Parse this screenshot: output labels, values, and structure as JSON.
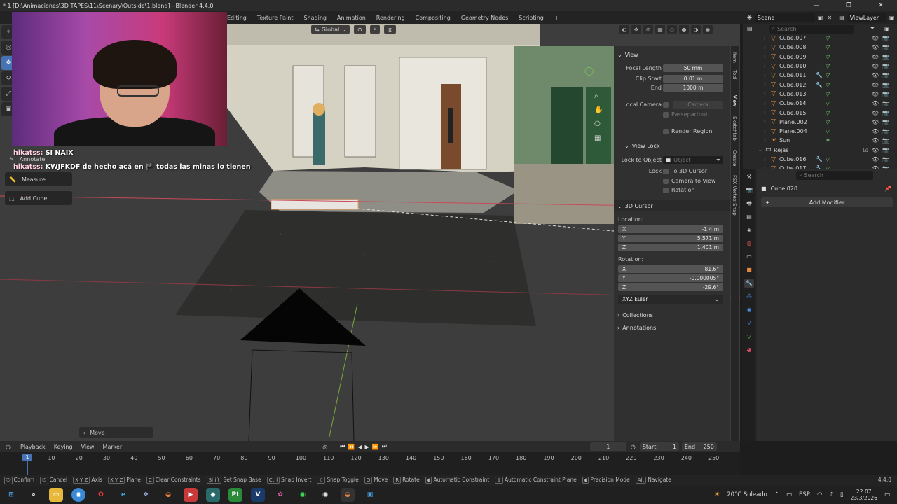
{
  "window": {
    "title": "* 1 [D:\\Animaciones\\3D TAPES\\11\\Scenary\\Outside\\1.blend] - Blender 4.4.0",
    "controls": [
      "—",
      "❐",
      "✕"
    ]
  },
  "workspaces": [
    "Editing",
    "Texture Paint",
    "Shading",
    "Animation",
    "Rendering",
    "Compositing",
    "Geometry Nodes",
    "Scripting",
    "+"
  ],
  "scene": {
    "label": "Scene",
    "view_layer": "ViewLayer"
  },
  "viewport": {
    "orientation": "Global",
    "tools": [
      "Annotate",
      "Measure",
      "Add Cube"
    ],
    "last_op": "Move"
  },
  "chat": [
    {
      "user": "hikatss:",
      "message": "SI NAIX"
    },
    {
      "user": "hikatss:",
      "message": "KWJFKDF de hecho acá en 🏴 todas las minas lo tienen"
    }
  ],
  "npanel": {
    "tabs": [
      "Item",
      "Tool",
      "View",
      "Sketchfab",
      "Create",
      "FSX Vertex Snap"
    ],
    "view": {
      "header": "View",
      "focal_length_label": "Focal Length",
      "focal_length": "50 mm",
      "clip_start_label": "Clip Start",
      "clip_start": "0.01 m",
      "end_label": "End",
      "end": "1000 m",
      "local_camera_label": "Local Camera",
      "local_camera_value": "Camera",
      "passepartout": "Passepartout",
      "render_region": "Render Region"
    },
    "view_lock": {
      "header": "View Lock",
      "lock_to_object_label": "Lock to Object",
      "lock_to_object_value": "Object",
      "lock_label": "Lock",
      "to_3d_cursor": "To 3D Cursor",
      "camera_to_view": "Camera to View",
      "rotation": "Rotation"
    },
    "cursor": {
      "header": "3D Cursor",
      "location_label": "Location:",
      "x_label": "X",
      "x": "-1.4 m",
      "y_label": "Y",
      "y": "5.571 m",
      "z_label": "Z",
      "z": "1.401 m",
      "rotation_label": "Rotation:",
      "rx": "81.6°",
      "ry": "-0.000005°",
      "rz": "-29.6°",
      "mode": "XYZ Euler"
    },
    "collections": "Collections",
    "annotations": "Annotations"
  },
  "outliner": {
    "search_placeholder": "Search",
    "rows": [
      {
        "name": "Cube.007",
        "mod": false
      },
      {
        "name": "Cube.008",
        "mod": false
      },
      {
        "name": "Cube.009",
        "mod": false
      },
      {
        "name": "Cube.010",
        "mod": false
      },
      {
        "name": "Cube.011",
        "mod": true
      },
      {
        "name": "Cube.012",
        "mod": true
      },
      {
        "name": "Cube.013",
        "mod": false
      },
      {
        "name": "Cube.014",
        "mod": false
      },
      {
        "name": "Cube.015",
        "mod": false
      },
      {
        "name": "Plane.002",
        "mod": false
      },
      {
        "name": "Plane.004",
        "mod": false
      },
      {
        "name": "Sun",
        "mod": false
      }
    ],
    "collection": "Rejas",
    "collection_rows": [
      {
        "name": "Cube.016",
        "mod": true
      },
      {
        "name": "Cube.017",
        "mod": true
      }
    ]
  },
  "properties": {
    "search_placeholder": "Search",
    "object_name": "Cube.020",
    "add_modifier": "Add Modifier"
  },
  "timeline": {
    "menus": [
      "Playback",
      "Keying",
      "View",
      "Marker"
    ],
    "current_frame": "1",
    "start_label": "Start",
    "start": "1",
    "end_label": "End",
    "end": "250",
    "playhead": "1",
    "ticks": [
      "10",
      "20",
      "30",
      "40",
      "50",
      "60",
      "70",
      "80",
      "90",
      "100",
      "110",
      "120",
      "130",
      "140",
      "150",
      "160",
      "170",
      "180",
      "190",
      "200",
      "210",
      "220",
      "230",
      "240",
      "250"
    ]
  },
  "statusbar": {
    "items": [
      {
        "key": "⎋",
        "label": "Confirm"
      },
      {
        "key": "⎋",
        "label": "Cancel"
      },
      {
        "key": "X Y Z",
        "label": "Axis"
      },
      {
        "key": "X Y Z",
        "label": "Plane"
      },
      {
        "key": "C",
        "label": "Clear Constraints"
      },
      {
        "key": "Shift",
        "label": "Set Snap Base"
      },
      {
        "key": "Ctrl",
        "label": "Snap Invert"
      },
      {
        "key": "⇧",
        "label": "Snap Toggle"
      },
      {
        "key": "G",
        "label": "Move"
      },
      {
        "key": "R",
        "label": "Rotate"
      },
      {
        "key": "",
        "label": "Automatic Constraint"
      },
      {
        "key": "⇧",
        "label": "Automatic Constraint Plane"
      },
      {
        "key": "",
        "label": "Precision Mode"
      },
      {
        "key": "Alt",
        "label": "Navigate"
      }
    ],
    "version": "4.4.0"
  },
  "taskbar": {
    "weather": "20°C Soleado",
    "lang": "ESP",
    "time": "22:07",
    "date": "23/3/2026"
  }
}
